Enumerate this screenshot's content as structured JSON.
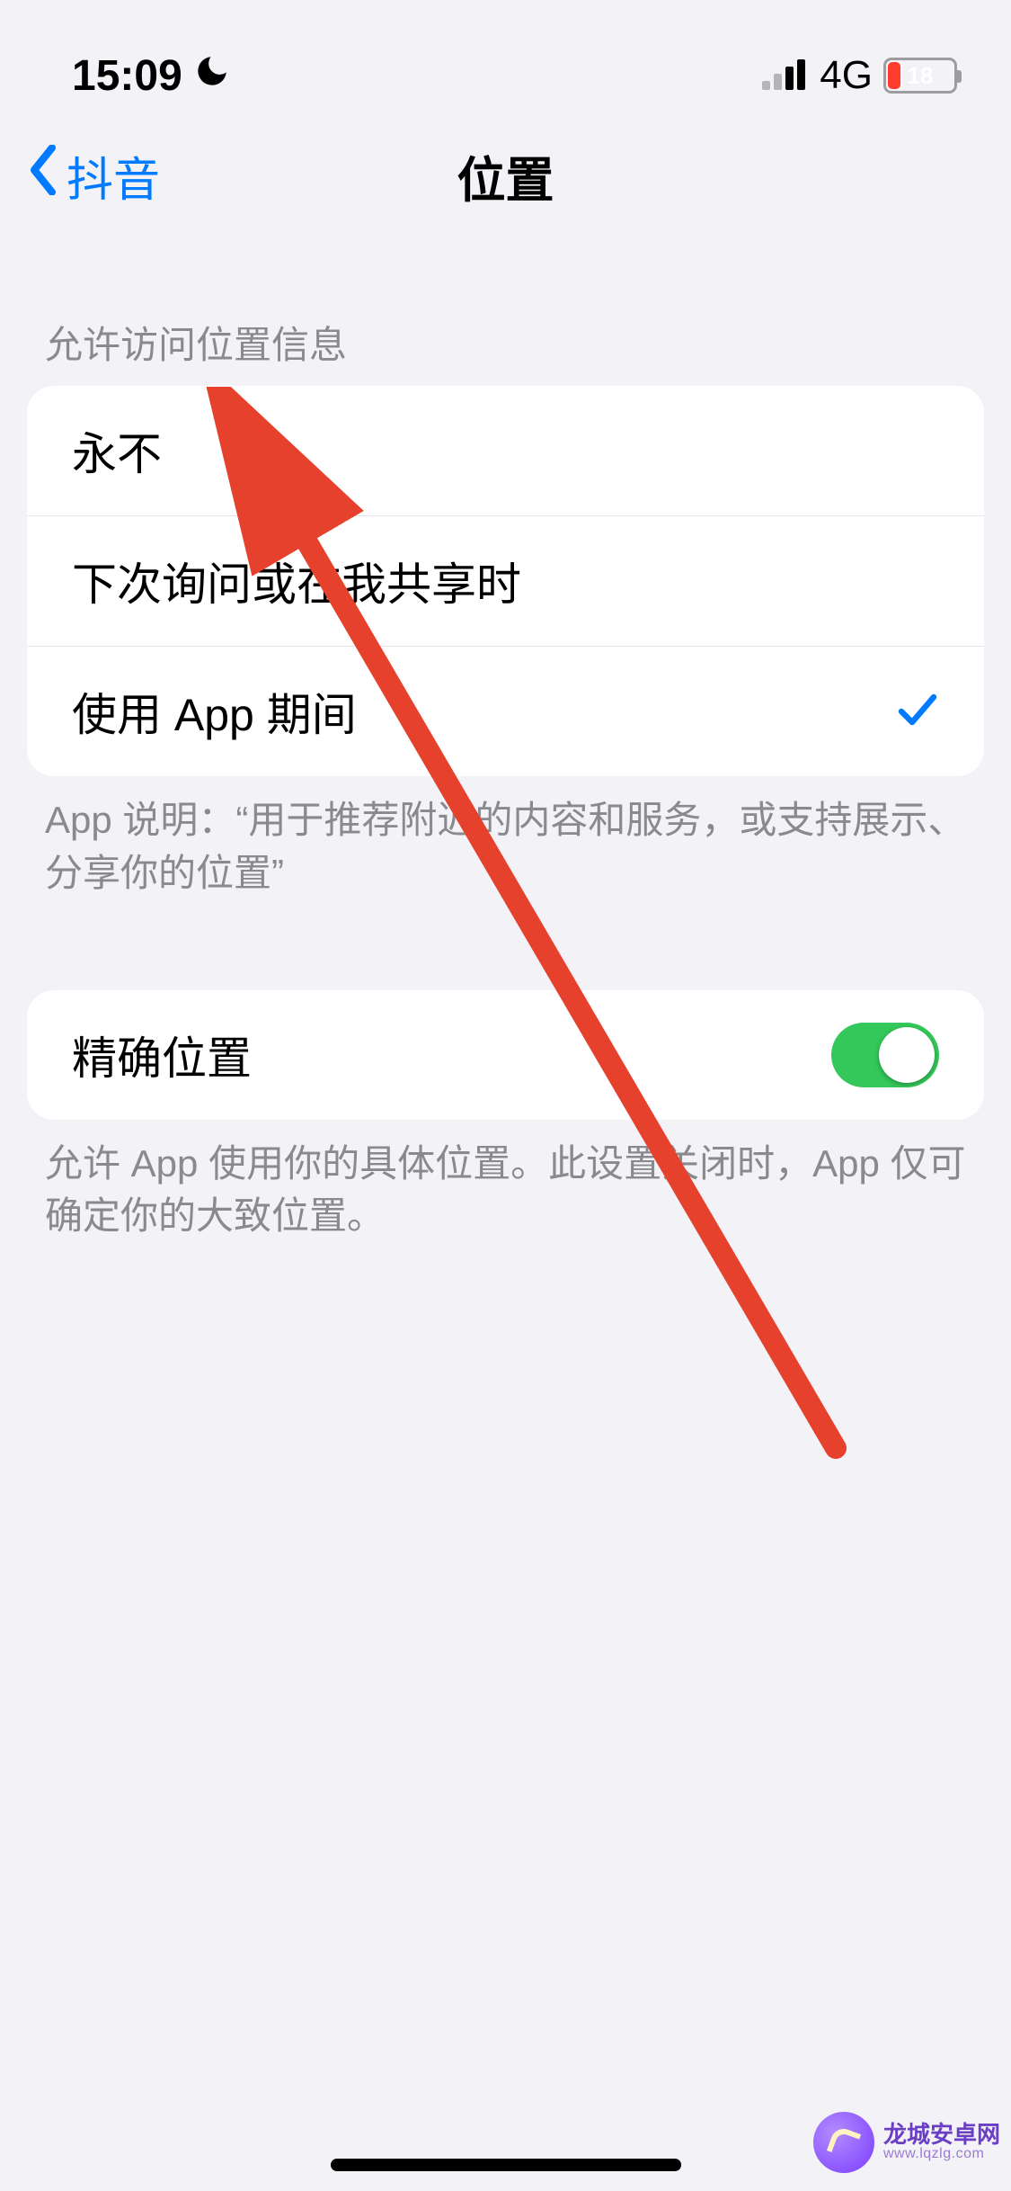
{
  "statusBar": {
    "time": "15:09",
    "dndIcon": "moon-icon",
    "networkLabel": "4G",
    "batteryPercent": "18"
  },
  "nav": {
    "backLabel": "抖音",
    "title": "位置"
  },
  "locationAccess": {
    "header": "允许访问位置信息",
    "options": {
      "never": "永不",
      "askNextTime": "下次询问或在我共享时",
      "whileUsing": "使用 App 期间"
    },
    "selected": "whileUsing",
    "footer": "App 说明：“用于推荐附近的内容和服务，或支持展示、分享你的位置”"
  },
  "preciseLocation": {
    "label": "精确位置",
    "on": true,
    "footer": "允许 App 使用你的具体位置。此设置关闭时，App 仅可确定你的大致位置。"
  },
  "colors": {
    "accent": "#007aff",
    "switchOn": "#34c759",
    "batteryLow": "#ff3b30",
    "arrow": "#e6412d"
  },
  "watermark": {
    "title": "龙城安卓网",
    "sub": "www.lqzlg.com"
  }
}
